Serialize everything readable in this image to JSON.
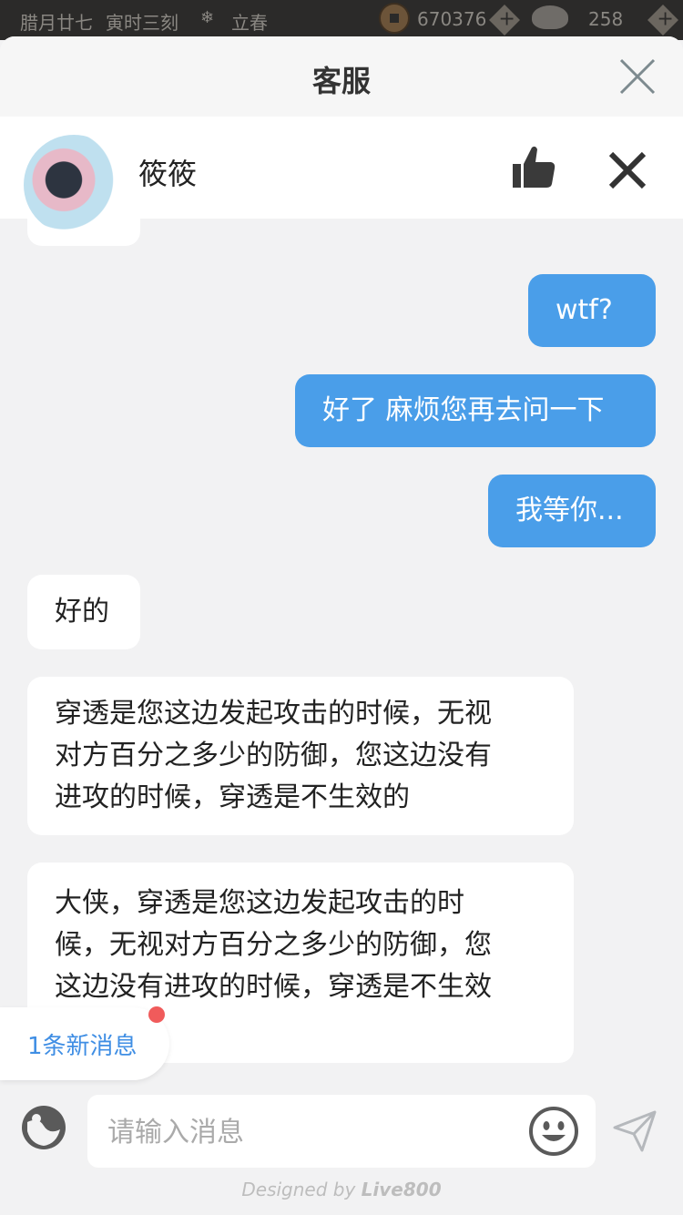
{
  "status_bar": {
    "lunar_date": "腊月廿七",
    "time": "寅时三刻",
    "solar_term": "立春",
    "coins": "670376",
    "ingots": "258"
  },
  "header": {
    "title": "客服"
  },
  "agent": {
    "name": "筱筱"
  },
  "messages": [
    {
      "from": "me",
      "text": "wtf?"
    },
    {
      "from": "me",
      "text": "好了 麻烦您再去问一下"
    },
    {
      "from": "me",
      "text": "我等你..."
    },
    {
      "from": "agent",
      "text": "好的"
    },
    {
      "from": "agent",
      "lines": [
        "穿透是您这边发起攻击的时候，无视",
        "对方百分之多少的防御，您这边没有",
        "进攻的时候，穿透是不生效的"
      ]
    },
    {
      "from": "agent",
      "lines": [
        "大侠，穿透是您这边发起攻击的时",
        "候，无视对方百分之多少的防御，您",
        "这边没有进攻的时候，穿透是不生效"
      ]
    }
  ],
  "new_message_notice": "1条新消息",
  "input": {
    "placeholder": "请输入消息",
    "value": ""
  },
  "footer": {
    "prefix": "Designed by ",
    "brand": "Live800"
  },
  "colors": {
    "my_bubble": "#4a9ee9",
    "accent": "#3f8ee4",
    "notice_dot": "#f05b5b"
  }
}
